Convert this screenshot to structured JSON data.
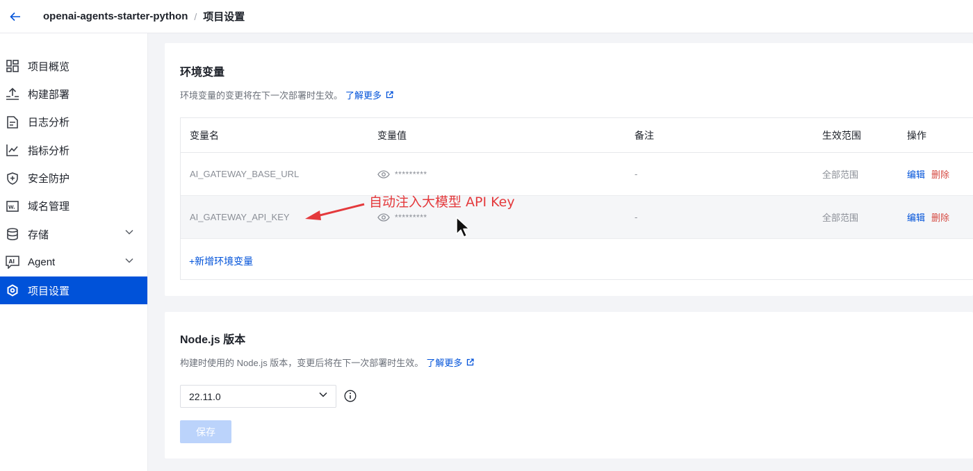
{
  "header": {
    "project_name": "openai-agents-starter-python",
    "separator": "/",
    "page_title": "项目设置"
  },
  "sidebar": {
    "items": [
      {
        "label": "项目概览",
        "icon": "dashboard-icon"
      },
      {
        "label": "构建部署",
        "icon": "upload-icon"
      },
      {
        "label": "日志分析",
        "icon": "log-icon"
      },
      {
        "label": "指标分析",
        "icon": "chart-icon"
      },
      {
        "label": "安全防护",
        "icon": "shield-icon"
      },
      {
        "label": "域名管理",
        "icon": "www-icon"
      },
      {
        "label": "存储",
        "icon": "database-icon",
        "expandable": true
      },
      {
        "label": "Agent",
        "icon": "ai-icon",
        "expandable": true
      },
      {
        "label": "项目设置",
        "icon": "settings-icon",
        "active": true
      }
    ]
  },
  "env_section": {
    "title": "环境变量",
    "description": "环境变量的变更将在下一次部署时生效。",
    "learn_more": "了解更多",
    "columns": [
      "变量名",
      "变量值",
      "备注",
      "生效范围",
      "操作"
    ],
    "rows": [
      {
        "name": "AI_GATEWAY_BASE_URL",
        "value_mask": "*********",
        "note": "-",
        "scope": "全部范围",
        "edit": "编辑",
        "delete": "删除"
      },
      {
        "name": "AI_GATEWAY_API_KEY",
        "value_mask": "*********",
        "note": "-",
        "scope": "全部范围",
        "edit": "编辑",
        "delete": "删除"
      }
    ],
    "add_label": "+新增环境变量"
  },
  "annotation": {
    "text": "自动注入大模型 API Key",
    "color": "#e4393c"
  },
  "node_section": {
    "title": "Node.js 版本",
    "description": "构建时使用的 Node.js 版本，变更后将在下一次部署时生效。",
    "learn_more": "了解更多",
    "selected_version": "22.11.0",
    "save_label": "保存"
  },
  "colors": {
    "accent": "#0052d9",
    "danger": "#d54941",
    "save_disabled": "#bbd3fb"
  }
}
